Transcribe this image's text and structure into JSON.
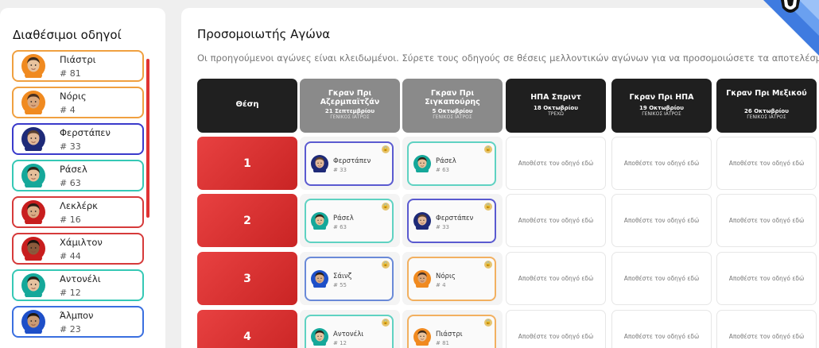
{
  "colors": {
    "orange": "#f0a040",
    "navy": "#3a3acb",
    "teal": "#35c8b5",
    "crimson": "#d63a3a",
    "blue": "#3a6fe0",
    "accent_red": "#e03333"
  },
  "sidebar": {
    "title": "Διαθέσιμοι οδηγοί",
    "drivers": [
      {
        "name": "Πιάστρι",
        "number": "# 81",
        "color": "#f0a040",
        "skin": "#e8c39e",
        "hair": "#3b2a1c",
        "shirt": "#f08a20"
      },
      {
        "name": "Νόρις",
        "number": "# 4",
        "color": "#f0a040",
        "skin": "#d9a77d",
        "hair": "#4a3020",
        "shirt": "#f08a20"
      },
      {
        "name": "Φερστάπεν",
        "number": "# 33",
        "color": "#3a3acb",
        "skin": "#e1b898",
        "hair": "#5a4030",
        "shirt": "#1e2a78"
      },
      {
        "name": "Ράσελ",
        "number": "# 63",
        "color": "#35c8b5",
        "skin": "#e6bf9a",
        "hair": "#2e2418",
        "shirt": "#15a89a"
      },
      {
        "name": "Λεκλέρκ",
        "number": "# 16",
        "color": "#d63a3a",
        "skin": "#d9ad86",
        "hair": "#2a1e14",
        "shirt": "#c81e1e"
      },
      {
        "name": "Χάμιλτον",
        "number": "# 44",
        "color": "#d63a3a",
        "skin": "#8a5a3c",
        "hair": "#1a120c",
        "shirt": "#c81e1e"
      },
      {
        "name": "Αντονέλι",
        "number": "# 12",
        "color": "#35c8b5",
        "skin": "#e6c29f",
        "hair": "#2a1f16",
        "shirt": "#15a89a"
      },
      {
        "name": "Άλμπον",
        "number": "# 23",
        "color": "#3a6fe0",
        "skin": "#c99a74",
        "hair": "#1f1610",
        "shirt": "#1e4fc8"
      }
    ]
  },
  "main": {
    "title": "Προσομοιωτής Αγώνα",
    "subtitle": "Οι προηγούμενοι αγώνες είναι κλειδωμένοι. Σύρετε τους οδηγούς σε θέσεις μελλοντικών αγώνων για να προσομοιώσετε τα αποτελέσματα.",
    "position_header": "Θέση",
    "drop_text": "Αποθέστε τον οδηγό εδώ",
    "lock_glyph": "🔒",
    "races": [
      {
        "title": "Γκραν Πρι Αζερμπαϊτζάν",
        "date": "21 Σεπτεμβρίου",
        "type": "ΓΕΝΙΚΟΣ ΙΑΤΡΟΣ",
        "locked": true
      },
      {
        "title": "Γκραν Πρι Σιγκαπούρης",
        "date": "5 Οκτωβρίου",
        "type": "ΓΕΝΙΚΟΣ ΙΑΤΡΟΣ",
        "locked": true
      },
      {
        "title": "ΗΠΑ Σπριντ",
        "date": "18 Οκτωβρίου",
        "type": "ΤΡΕΧΩ",
        "locked": false
      },
      {
        "title": "Γκραν Πρι ΗΠΑ",
        "date": "19 Οκτωβρίου",
        "type": "ΓΕΝΙΚΟΣ ΙΑΤΡΟΣ",
        "locked": false
      },
      {
        "title": "Γκραν Πρι Μεξικού",
        "date": "26 Οκτωβρίου",
        "type": "ΓΕΝΙΚΟΣ ΙΑΤΡΟΣ",
        "locked": false
      }
    ],
    "rows": [
      {
        "position": "1",
        "results": [
          {
            "name": "Φερστάπεν",
            "number": "# 33",
            "color": "#5a5ad0",
            "skin": "#e1b898",
            "hair": "#5a4030",
            "shirt": "#1e2a78"
          },
          {
            "name": "Ράσελ",
            "number": "# 63",
            "color": "#5fd2c2",
            "skin": "#e6bf9a",
            "hair": "#2e2418",
            "shirt": "#15a89a"
          }
        ]
      },
      {
        "position": "2",
        "results": [
          {
            "name": "Ράσελ",
            "number": "# 63",
            "color": "#5fd2c2",
            "skin": "#e6bf9a",
            "hair": "#2e2418",
            "shirt": "#15a89a"
          },
          {
            "name": "Φερστάπεν",
            "number": "# 33",
            "color": "#5a5ad0",
            "skin": "#e1b898",
            "hair": "#5a4030",
            "shirt": "#1e2a78"
          }
        ]
      },
      {
        "position": "3",
        "results": [
          {
            "name": "Σάινζ",
            "number": "# 55",
            "color": "#6a8ad8",
            "skin": "#d9ad86",
            "hair": "#2a1e14",
            "shirt": "#1e4fc8"
          },
          {
            "name": "Νόρις",
            "number": "# 4",
            "color": "#f2b060",
            "skin": "#d9a77d",
            "hair": "#4a3020",
            "shirt": "#f08a20"
          }
        ]
      },
      {
        "position": "4",
        "results": [
          {
            "name": "Αντονέλι",
            "number": "# 12",
            "color": "#5fd2c2",
            "skin": "#e6c29f",
            "hair": "#2a1f16",
            "shirt": "#15a89a"
          },
          {
            "name": "Πιάστρι",
            "number": "# 81",
            "color": "#f2b060",
            "skin": "#e8c39e",
            "hair": "#3b2a1c",
            "shirt": "#f08a20"
          }
        ]
      }
    ]
  }
}
